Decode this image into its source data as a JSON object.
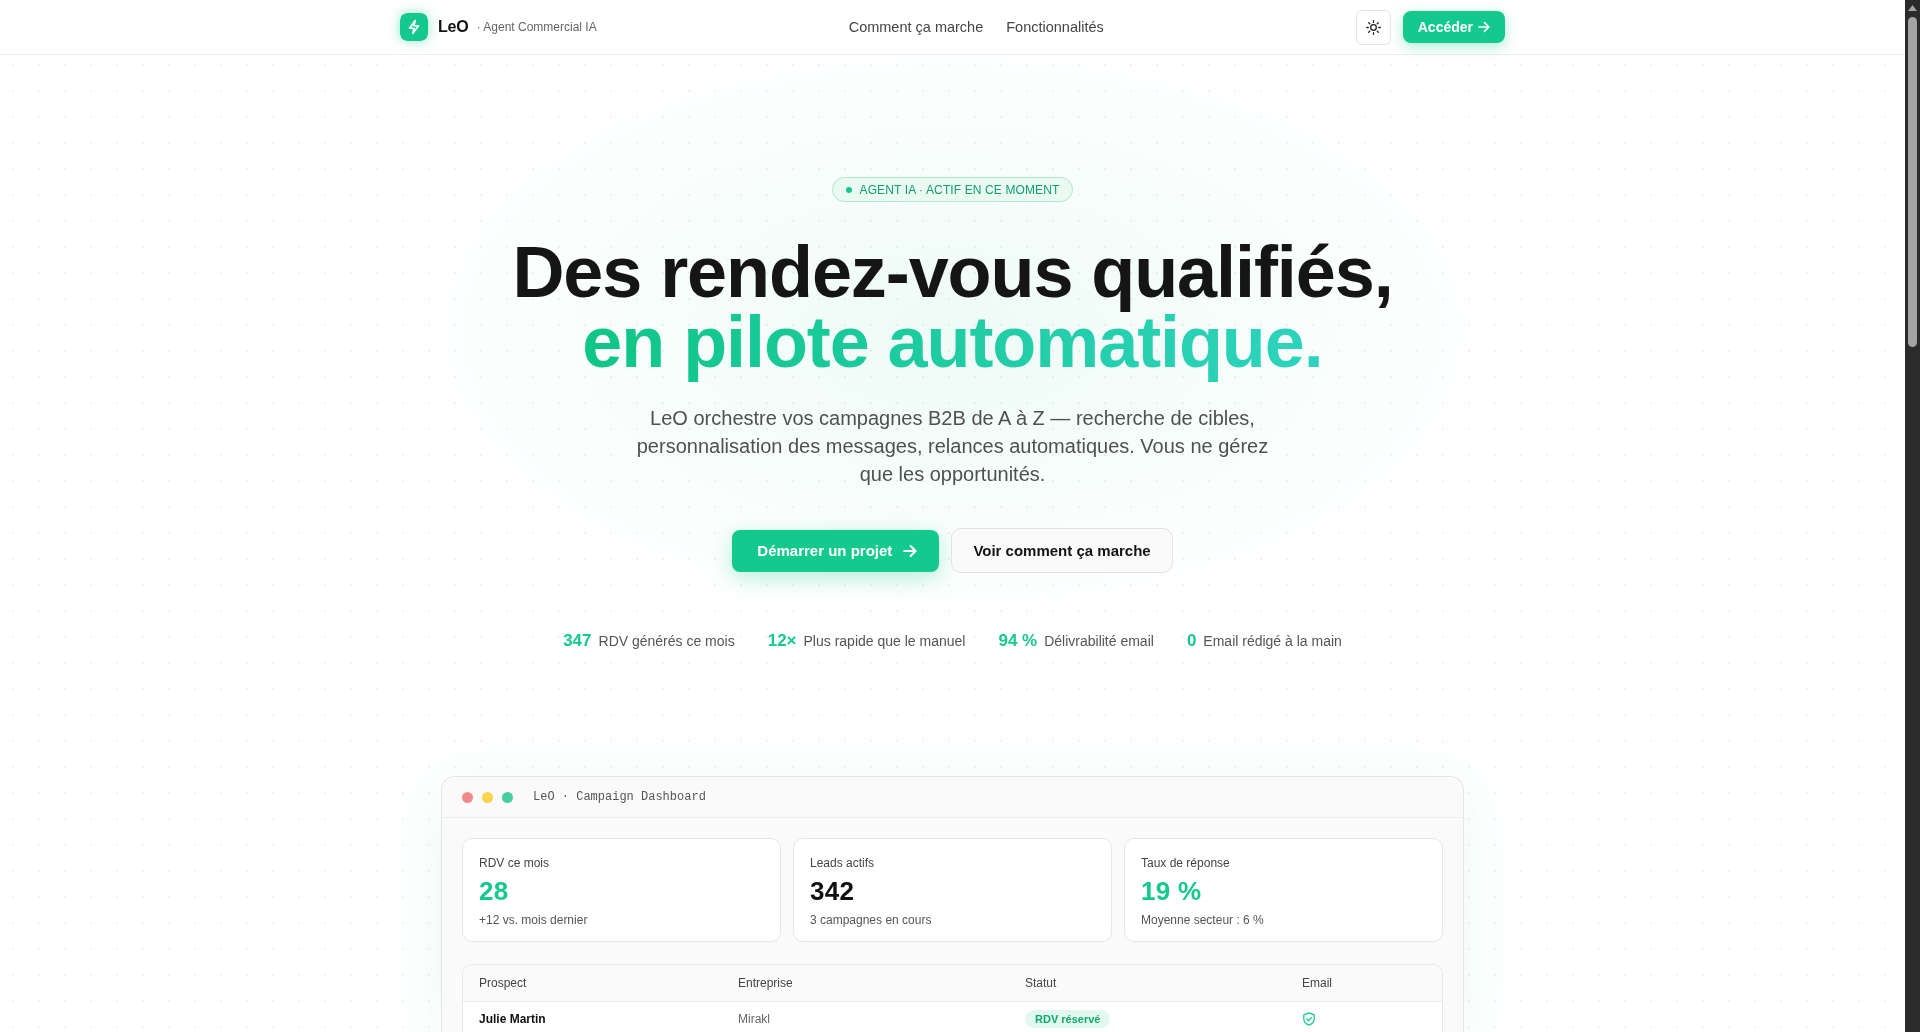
{
  "header": {
    "brand": {
      "name": "LeO",
      "tagline": "· Agent Commercial IA"
    },
    "nav": [
      {
        "label": "Comment ça marche"
      },
      {
        "label": "Fonctionnalités"
      }
    ],
    "cta": {
      "label": "Accéder"
    }
  },
  "hero": {
    "badge": "AGENT IA · ACTIF EN CE MOMENT",
    "headline": [
      {
        "text": "Des rendez-vous qualifiés,",
        "kind": "plain"
      },
      {
        "text": "en pilote automatique.",
        "kind": "accent"
      }
    ],
    "description": "LeO orchestre vos campagnes B2B de A à Z — recherche de cibles, personnalisation des messages, relances automatiques. Vous ne gérez que les opportunités.",
    "buttons": [
      {
        "label": "Démarrer un projet",
        "kind": "primary"
      },
      {
        "label": "Voir comment ça marche",
        "kind": "secondary"
      }
    ],
    "stats": [
      {
        "value": "347",
        "label": "RDV générés ce mois"
      },
      {
        "value": "12×",
        "label": "Plus rapide que le manuel"
      },
      {
        "value": "94 %",
        "label": "Délivrabilité email"
      },
      {
        "value": "0",
        "label": "Email rédigé à la main"
      }
    ]
  },
  "dashboard": {
    "title": "LeO · Campaign Dashboard",
    "metrics": [
      {
        "label": "RDV ce mois",
        "value": "28",
        "note": "+12 vs. mois dernier",
        "kind": "accent"
      },
      {
        "label": "Leads actifs",
        "value": "342",
        "note": "3 campagnes en cours",
        "kind": "plain"
      },
      {
        "label": "Taux de réponse",
        "value": "19 %",
        "note": "Moyenne secteur : 6 %",
        "kind": "accent"
      }
    ],
    "table": {
      "columns": [
        "Prospect",
        "Entreprise",
        "Statut",
        "Email"
      ],
      "rows": [
        {
          "prospect": "Julie Martin",
          "company": "Mirakl",
          "status": "RDV réservé",
          "email_verified": true
        }
      ]
    }
  }
}
